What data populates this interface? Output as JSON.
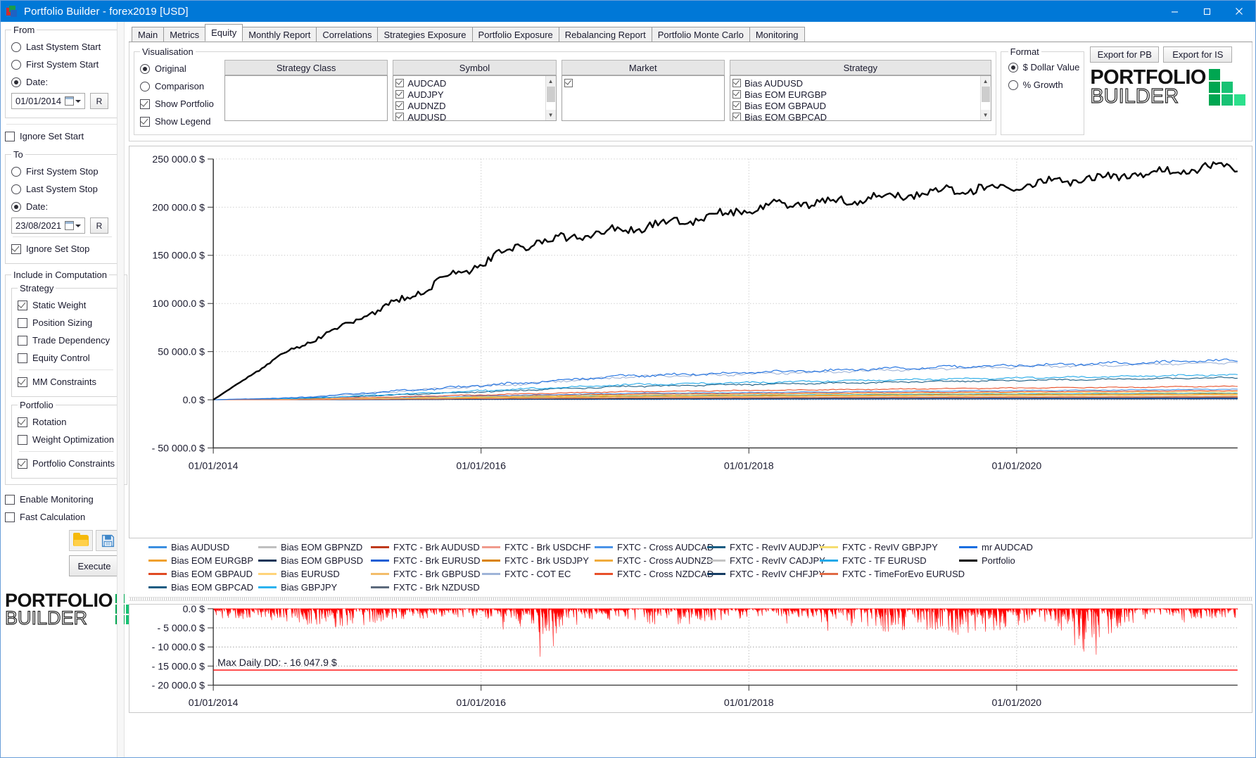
{
  "window": {
    "title": "Portfolio Builder - forex2019 [USD]",
    "minimize": "minimize",
    "maximize": "maximize",
    "close": "close"
  },
  "left_panel": {
    "from": {
      "legend": "From",
      "options": [
        "Last Stystem Start",
        "First System Start",
        "Date:"
      ],
      "selected": "Date:",
      "date_value": "01/01/2014",
      "reset_label": "R",
      "ignore_label": "Ignore Set Start",
      "ignore_checked": false
    },
    "to": {
      "legend": "To",
      "options": [
        "First System Stop",
        "Last System Stop",
        "Date:"
      ],
      "selected": "Date:",
      "date_value": "23/08/2021",
      "reset_label": "R",
      "ignore_label": "Ignore Set Stop",
      "ignore_checked": true
    },
    "include": {
      "legend": "Include in Computation",
      "strategy_legend": "Strategy",
      "strategy_items": [
        {
          "label": "Static Weight",
          "checked": true
        },
        {
          "label": "Position Sizing",
          "checked": false
        },
        {
          "label": "Trade Dependency",
          "checked": false
        },
        {
          "label": "Equity Control",
          "checked": false
        }
      ],
      "mm_constraints": {
        "label": "MM Constraints",
        "checked": true
      },
      "portfolio_legend": "Portfolio",
      "portfolio_items": [
        {
          "label": "Rotation",
          "checked": true
        },
        {
          "label": "Weight Optimization",
          "checked": false
        }
      ],
      "portfolio_constraints": {
        "label": "Portfolio Constraints",
        "checked": true
      }
    },
    "enable_monitoring": {
      "label": "Enable Monitoring",
      "checked": false
    },
    "fast_calculation": {
      "label": "Fast Calculation",
      "checked": false
    },
    "open_icon": "folder-open-icon",
    "save_icon": "floppy-disk-save-icon",
    "execute_label": "Execute",
    "logo_line1": "PORTFOLIO",
    "logo_line2": "BUILDER"
  },
  "tabs": [
    {
      "label": "Main",
      "active": false
    },
    {
      "label": "Metrics",
      "active": false
    },
    {
      "label": "Equity",
      "active": true
    },
    {
      "label": "Monthly Report",
      "active": false
    },
    {
      "label": "Correlations",
      "active": false
    },
    {
      "label": "Strategies Exposure",
      "active": false
    },
    {
      "label": "Portfolio Exposure",
      "active": false
    },
    {
      "label": "Rebalancing Report",
      "active": false
    },
    {
      "label": "Portfolio Monte Carlo",
      "active": false
    },
    {
      "label": "Monitoring",
      "active": false
    }
  ],
  "toolbar": {
    "visualisation_legend": "Visualisation",
    "vis_options": [
      {
        "label": "Original",
        "selected": true
      },
      {
        "label": "Comparison",
        "selected": false
      }
    ],
    "vis_checks": [
      {
        "label": "Show Portfolio",
        "checked": true
      },
      {
        "label": "Show Legend",
        "checked": true
      }
    ],
    "lists": [
      {
        "header": "Strategy Class",
        "items": [],
        "scroll": false
      },
      {
        "header": "Symbol",
        "scroll": true,
        "items": [
          {
            "label": "AUDCAD",
            "checked": true
          },
          {
            "label": "AUDJPY",
            "checked": true
          },
          {
            "label": "AUDNZD",
            "checked": true
          },
          {
            "label": "AUDUSD",
            "checked": true
          }
        ]
      },
      {
        "header": "Market",
        "scroll": false,
        "items": [
          {
            "label": "",
            "checked": true
          }
        ]
      },
      {
        "header": "Strategy",
        "scroll": true,
        "items": [
          {
            "label": "Bias AUDUSD",
            "checked": true
          },
          {
            "label": "Bias EOM EURGBP",
            "checked": true
          },
          {
            "label": "Bias EOM GBPAUD",
            "checked": true
          },
          {
            "label": "Bias EOM GBPCAD",
            "checked": true
          }
        ]
      }
    ],
    "format_legend": "Format",
    "format_options": [
      {
        "label": "$ Dollar Value",
        "selected": true
      },
      {
        "label": "% Growth",
        "selected": false
      }
    ],
    "export_pb": "Export for PB",
    "export_is": "Export for IS",
    "logo_line1": "PORTFOLIO",
    "logo_line2": "BUILDER"
  },
  "chart_data": {
    "type": "line",
    "title": "",
    "xlabel": "",
    "ylabel": "",
    "xticks": [
      "01/01/2014",
      "01/01/2016",
      "01/01/2018",
      "01/01/2020"
    ],
    "yticks": [
      "250 000.0 $",
      "200 000.0 $",
      "150 000.0 $",
      "100 000.0 $",
      "50 000.0 $",
      "0.0 $",
      "- 50 000.0 $"
    ],
    "ylim": [
      -50000,
      250000
    ],
    "xlim": [
      "01/01/2014",
      "23/08/2021"
    ],
    "grid": true,
    "legend_position": "bottom",
    "series": [
      {
        "name": "Bias AUDUSD",
        "color": "#3b8fe0",
        "final": 1800
      },
      {
        "name": "Bias EOM EURGBP",
        "color": "#f0a02e",
        "final": 3200
      },
      {
        "name": "Bias EOM GBPAUD",
        "color": "#e04a23",
        "final": 9500
      },
      {
        "name": "Bias EOM GBPCAD",
        "color": "#1a5c82",
        "final": 2600
      },
      {
        "name": "Bias EOM GBPNZD",
        "color": "#bfbfbf",
        "final": 1500
      },
      {
        "name": "Bias EOM GBPUSD",
        "color": "#123457",
        "final": 900
      },
      {
        "name": "Bias EURUSD",
        "color": "#ffd47a",
        "final": 5200
      },
      {
        "name": "Bias GBPJPY",
        "color": "#2bb3ef",
        "final": 7000
      },
      {
        "name": "FXTC - Brk AUDUSD",
        "color": "#bf3a1c",
        "final": 2000
      },
      {
        "name": "FXTC - Brk EURUSD",
        "color": "#1a5ed4",
        "final": 1200
      },
      {
        "name": "FXTC - Brk GBPUSD",
        "color": "#f3bd6a",
        "final": 4000
      },
      {
        "name": "FXTC - Brk NZDUSD",
        "color": "#5c6a7c",
        "final": 2400
      },
      {
        "name": "FXTC - Brk USDCHF",
        "color": "#f09a8c",
        "final": 2900
      },
      {
        "name": "FXTC - Brk USDJPY",
        "color": "#d98200",
        "final": 6200
      },
      {
        "name": "FXTC - COT EC",
        "color": "#9fb4d8",
        "final": 39000
      },
      {
        "name": "FXTC - Cross AUDCAD",
        "color": "#4a93e8",
        "final": 11000
      },
      {
        "name": "FXTC - Cross AUDNZD",
        "color": "#f0ab3c",
        "final": 5800
      },
      {
        "name": "FXTC - Cross NZDCAD",
        "color": "#e8502a",
        "final": 14000
      },
      {
        "name": "FXTC - RevIV AUDJPY",
        "color": "#1a5c82",
        "final": 23000
      },
      {
        "name": "FXTC - RevIV CADJPY",
        "color": "#c4c4c4",
        "final": 3600
      },
      {
        "name": "FXTC - RevIV CHFJPY",
        "color": "#153c63",
        "final": 1700
      },
      {
        "name": "FXTC - RevIV GBPJPY",
        "color": "#f5dd70",
        "final": 8200
      },
      {
        "name": "FXTC - TF EURUSD",
        "color": "#22a9e8",
        "final": 26000
      },
      {
        "name": "FXTC - TimeForEvo EURUSD",
        "color": "#e06a45",
        "final": 3100
      },
      {
        "name": "mr AUDCAD",
        "color": "#1a6ee0",
        "final": 41000
      },
      {
        "name": "Portfolio",
        "color": "#000000",
        "final": 243000
      }
    ]
  },
  "drawdown_chart": {
    "type": "area",
    "yticks": [
      "0.0 $",
      "- 5 000.0 $",
      "- 10 000.0 $",
      "- 15 000.0 $",
      "- 20 000.0 $"
    ],
    "xticks": [
      "01/01/2014",
      "01/01/2016",
      "01/01/2018",
      "01/01/2020"
    ],
    "ylim": [
      -20000,
      0
    ],
    "fill_color": "#ff0000",
    "max_dd_label": "Max Daily DD: - 16 047.9 $",
    "max_dd_value": -16047.9,
    "max_dd_line_color": "#ff0000"
  }
}
